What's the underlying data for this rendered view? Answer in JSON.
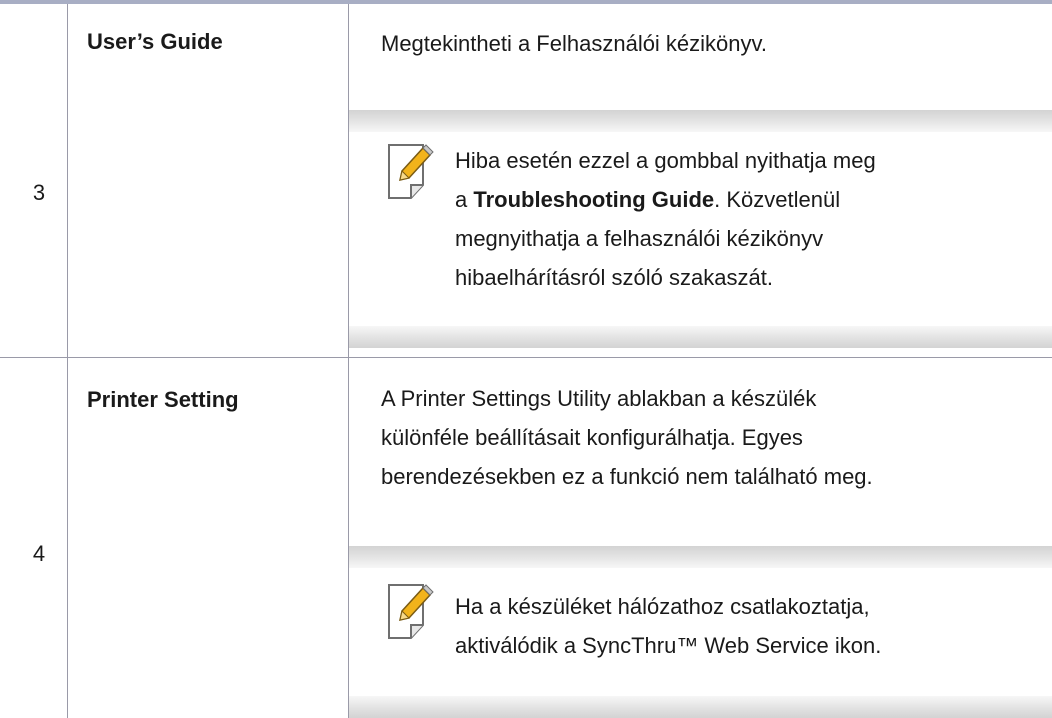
{
  "rows": [
    {
      "number": "3",
      "title": "User’s Guide",
      "description": "Megtekintheti a Felhasználói kézikönyv.",
      "note": {
        "icon": "note-pencil-icon",
        "lines": [
          {
            "text": "Hiba esetén ezzel a gombbal nyithatja meg"
          },
          {
            "prefix": "a ",
            "bold": "Troubleshooting Guide",
            "suffix": ". Közvetlenül"
          },
          {
            "text": "megnyithatja a felhasználói kézikönyv"
          },
          {
            "text": "hibaelhárításról szóló szakaszát."
          }
        ]
      }
    },
    {
      "number": "4",
      "title": "Printer Setting",
      "description_lines": [
        "A Printer Settings Utility ablakban a készülék",
        "különféle beállításait konfigurálhatja. Egyes",
        "berendezésekben ez a funkció nem található meg."
      ],
      "note": {
        "icon": "note-pencil-icon",
        "lines": [
          {
            "text": "Ha a készüléket hálózathoz csatlakoztatja,"
          },
          {
            "text": "aktiválódik a SyncThru™ Web Service ikon."
          }
        ]
      }
    }
  ],
  "colors": {
    "rule": "#a8aec4",
    "grid": "#9a9aa8",
    "note_bar": "#d3d3d3",
    "icon_pencil": "#f2b31b"
  }
}
